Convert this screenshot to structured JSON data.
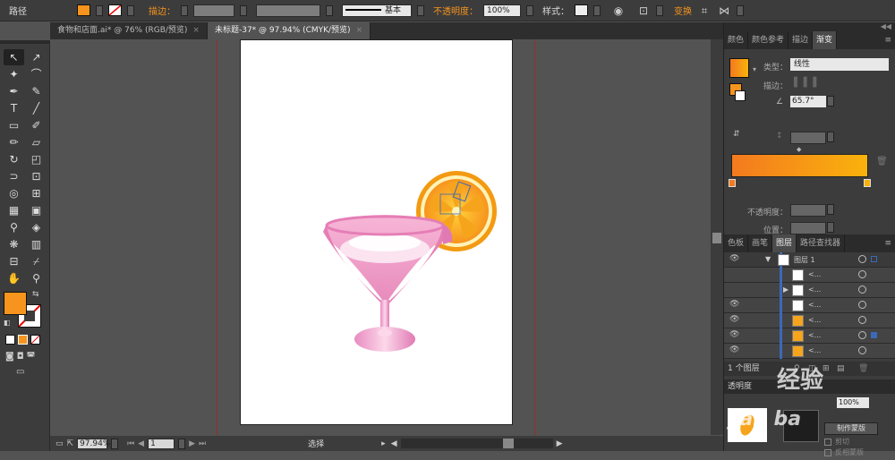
{
  "control_bar": {
    "object_type": "路径",
    "stroke_label": "描边：",
    "stroke_style": "基本",
    "opacity_label": "不透明度：",
    "opacity_value": "100%",
    "style_label": "样式：",
    "transform_label": "变换",
    "fill_color": "#f7941d",
    "accent_color": "#f7941d"
  },
  "doc_tabs": [
    {
      "label": "食物和店面.ai* @ 76% (RGB/预览)",
      "active": false
    },
    {
      "label": "未标题-37* @ 97.94% (CMYK/预览)",
      "active": true
    }
  ],
  "tools": {
    "rows": [
      [
        "selection-tool",
        "direct-selection-tool"
      ],
      [
        "magic-wand-tool",
        "lasso-tool"
      ],
      [
        "pen-tool",
        "curvature-tool"
      ],
      [
        "type-tool",
        "line-tool"
      ],
      [
        "rectangle-tool",
        "paintbrush-tool"
      ],
      [
        "pencil-tool",
        "eraser-tool"
      ],
      [
        "rotate-tool",
        "scale-tool"
      ],
      [
        "width-tool",
        "free-transform-tool"
      ],
      [
        "shape-builder-tool",
        "perspective-grid-tool"
      ],
      [
        "mesh-tool",
        "gradient-tool"
      ],
      [
        "eyedropper-tool",
        "blend-tool"
      ],
      [
        "symbol-sprayer-tool",
        "column-graph-tool"
      ],
      [
        "artboard-tool",
        "slice-tool"
      ],
      [
        "hand-tool",
        "zoom-tool"
      ]
    ],
    "glyphs": [
      "↖",
      "↗",
      "✦",
      "⌒",
      "✒",
      "✎",
      "T",
      "╱",
      "▭",
      "✐",
      "✏",
      "▱",
      "↻",
      "◰",
      "⊃",
      "⊡",
      "◎",
      "⊞",
      "▦",
      "▣",
      "⚲",
      "◈",
      "❋",
      "▥",
      "⊟",
      "⌿",
      "✋",
      "⚲"
    ],
    "fill": "#f7941d"
  },
  "status_bar": {
    "zoom": "97.94%",
    "page": "1",
    "tool_name": "选择"
  },
  "gradient_panel": {
    "tabs": [
      "颜色",
      "颜色参考",
      "描边",
      "渐变"
    ],
    "active_tab": "渐变",
    "type_label": "类型：",
    "type_value": "线性",
    "stroke_label": "描边：",
    "angle_value": "65.7°",
    "opacity_label": "不透明度：",
    "location_label": "位置：",
    "stop_left": "#f47a1f",
    "stop_right": "#f9b20c"
  },
  "layers_panel": {
    "tabs": [
      "色板",
      "画笔",
      "图层",
      "路径查找器"
    ],
    "active_tab": "图层",
    "layer_name": "图层 1",
    "sublayer_label": "<...",
    "footer_count": "1 个图层"
  },
  "transparency_panel": {
    "title": "透明度",
    "opacity": "100%",
    "make_mask": "制作蒙版",
    "clip_label": "剪切",
    "invert_label": "反相蒙版"
  },
  "watermark": {
    "text1": "经验",
    "text2": "yan ba"
  }
}
